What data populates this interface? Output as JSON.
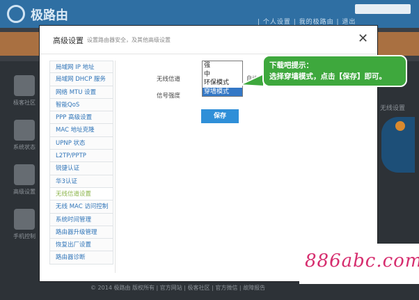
{
  "background": {
    "app_title": "极路由",
    "top_links": "| 个人设置 | 我的极路由 | 退出",
    "side_items": [
      "极客社区",
      "系统状态",
      "高级设置",
      "手机控制"
    ],
    "right_label": "无线设置",
    "footer": "© 2014 极路由 版权所有 | 官方网站 | 极客社区 | 官方微信 | 故障报告"
  },
  "modal": {
    "title": "高级设置",
    "subtitle": "设置路由器安全，及其他高级设置",
    "close_icon": "close-icon",
    "nav": [
      {
        "label": "局域网 IP 地址",
        "active": false
      },
      {
        "label": "局域网 DHCP 服务",
        "active": false
      },
      {
        "label": "网络 MTU 设置",
        "active": false
      },
      {
        "label": "智能QoS",
        "active": false
      },
      {
        "label": "PPP 高级设置",
        "active": false
      },
      {
        "label": "MAC 地址克隆",
        "active": false
      },
      {
        "label": "UPNP 状态",
        "active": false
      },
      {
        "label": "L2TP/PPTP",
        "active": false
      },
      {
        "label": "锐捷认证",
        "active": false
      },
      {
        "label": "华3认证",
        "active": false
      },
      {
        "label": "无线信道设置",
        "active": true
      },
      {
        "label": "无线 MAC 访问控制",
        "active": false
      },
      {
        "label": "系统时间管理",
        "active": false
      },
      {
        "label": "路由器升级管理",
        "active": false
      },
      {
        "label": "恢复出厂设置",
        "active": false
      },
      {
        "label": "路由器诊断",
        "active": false
      }
    ],
    "channel_label": "无线信道",
    "channel_value": "自动",
    "signal_label": "信号强度",
    "signal_options": [
      "强",
      "中",
      "环保模式",
      "穿墙模式"
    ],
    "signal_selected": "穿墙模式",
    "save_label": "保存"
  },
  "tooltip": {
    "line1": "下载吧提示：",
    "line2": "选择穿墙模式，点击【保存】即可。"
  },
  "watermark": {
    "text": "886abc.com"
  },
  "colors": {
    "accent_blue": "#2f8fd8",
    "link_blue": "#2f74b8",
    "active_green": "#8cb54b",
    "tip_green": "#3ea83d",
    "watermark_pink": "#d62d6e"
  }
}
